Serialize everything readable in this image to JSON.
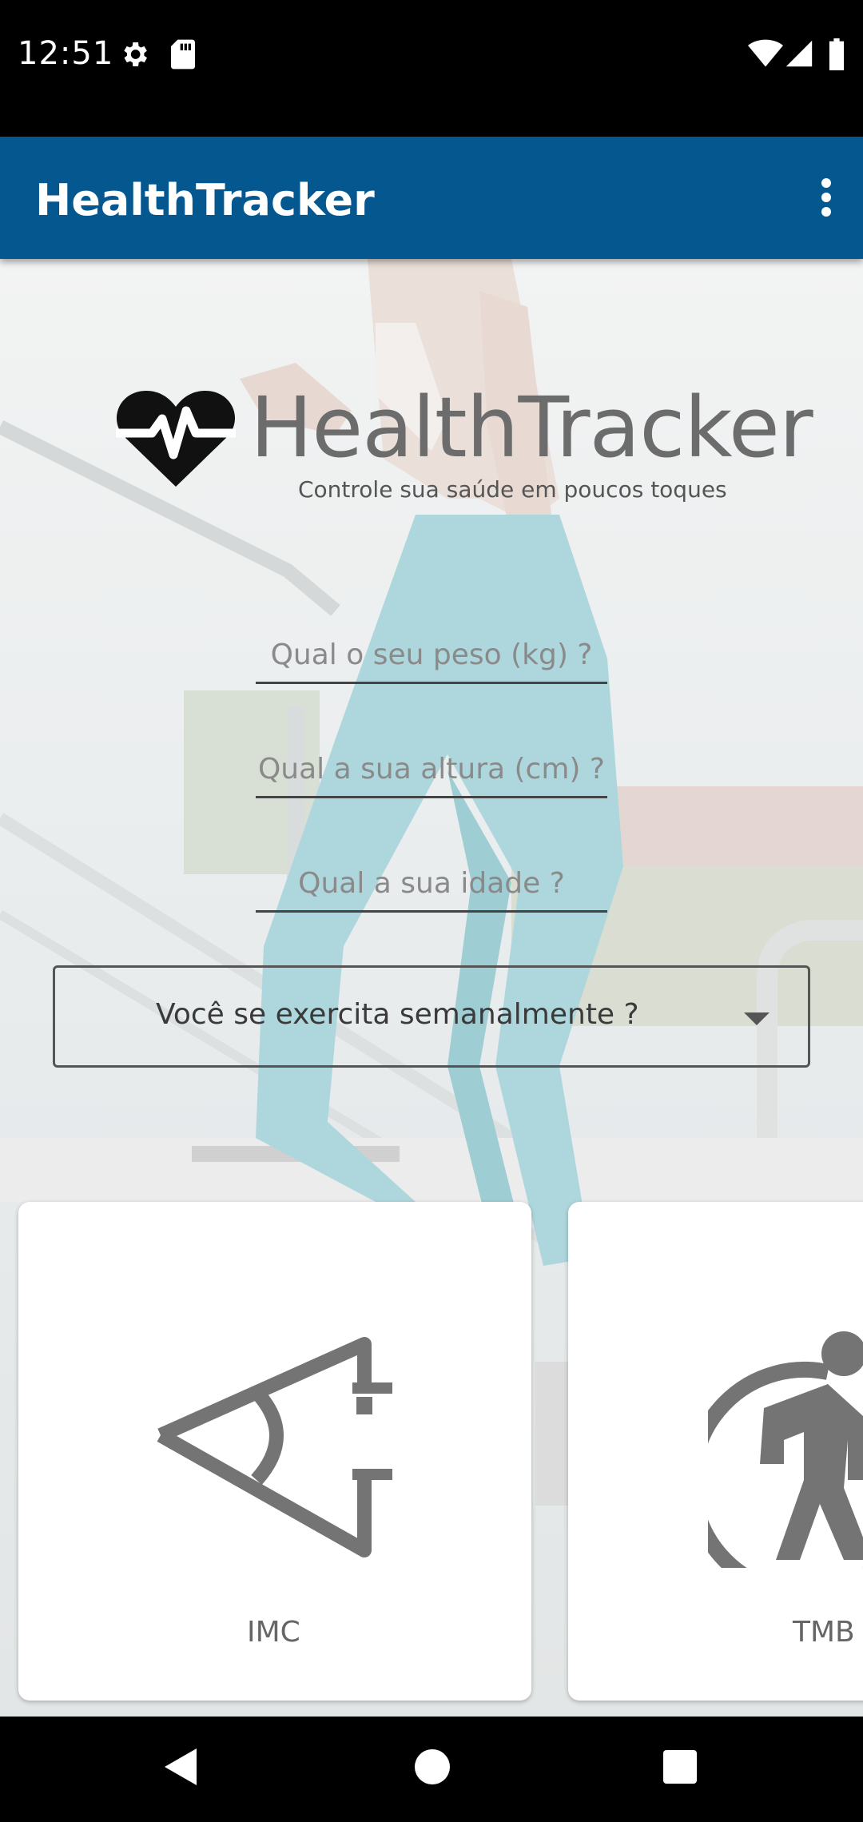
{
  "status_bar": {
    "time": "12:51"
  },
  "app_bar": {
    "title": "HealthTracker"
  },
  "logo": {
    "name": "HealthTracker",
    "tagline": "Controle sua saúde em poucos toques"
  },
  "form": {
    "weight": {
      "placeholder": "Qual o seu peso (kg) ?",
      "value": ""
    },
    "height": {
      "placeholder": "Qual a sua altura (cm) ?",
      "value": ""
    },
    "age": {
      "placeholder": "Qual a sua idade ?",
      "value": ""
    },
    "exercise_select": {
      "selected": "Você se exercita semanalmente ?"
    }
  },
  "cards": [
    {
      "label": "IMC",
      "icon": "imc-ruler-icon"
    },
    {
      "label": "TMB",
      "icon": "walking-person-icon"
    }
  ],
  "colors": {
    "app_bar": "#05578f",
    "icon_gray": "#747474",
    "status_bar": "#000000"
  }
}
